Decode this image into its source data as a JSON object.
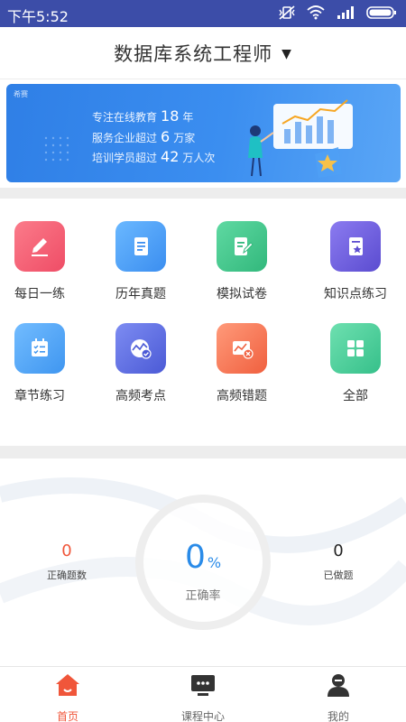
{
  "status_bar": {
    "time": "下午5:52"
  },
  "header": {
    "title": "数据库系统工程师"
  },
  "banner": {
    "logo": "希赛",
    "lines": [
      {
        "prefix": "专注在线教育",
        "number": "18",
        "suffix": "年"
      },
      {
        "prefix": "服务企业超过",
        "number": "6",
        "suffix": "万家"
      },
      {
        "prefix": "培训学员超过",
        "number": "42",
        "suffix": "万人次"
      }
    ]
  },
  "grid": {
    "items": [
      {
        "label": "每日一练",
        "icon": "pencil-icon",
        "color": "#f3586f"
      },
      {
        "label": "历年真题",
        "icon": "document-icon",
        "color": "#3b9cf4"
      },
      {
        "label": "模拟试卷",
        "icon": "paper-edit-icon",
        "color": "#3fc48b"
      },
      {
        "label": "知识点练习",
        "icon": "book-star-icon",
        "color": "#6a5bd9"
      },
      {
        "label": "章节练习",
        "icon": "checklist-icon",
        "color": "#4aa3f5"
      },
      {
        "label": "高频考点",
        "icon": "chart-check-icon",
        "color": "#5b6de0"
      },
      {
        "label": "高频错题",
        "icon": "chart-error-icon",
        "color": "#f6775a"
      },
      {
        "label": "全部",
        "icon": "grid-icon",
        "color": "#3fca96"
      }
    ]
  },
  "stats": {
    "correct_rate": {
      "value": "0",
      "unit": "%",
      "label": "正确率"
    },
    "correct_count": {
      "value": "0",
      "label": "正确题数",
      "color": "#f0563a"
    },
    "done_count": {
      "value": "0",
      "label": "已做题",
      "color": "#222222"
    }
  },
  "bottom_nav": {
    "items": [
      {
        "label": "首页",
        "icon": "home-icon",
        "active": true
      },
      {
        "label": "课程中心",
        "icon": "course-screen-icon",
        "active": false
      },
      {
        "label": "我的",
        "icon": "profile-icon",
        "active": false
      }
    ]
  },
  "colors": {
    "status_bar": "#3c4da8",
    "accent": "#f0563a",
    "rate": "#2a8be8"
  }
}
